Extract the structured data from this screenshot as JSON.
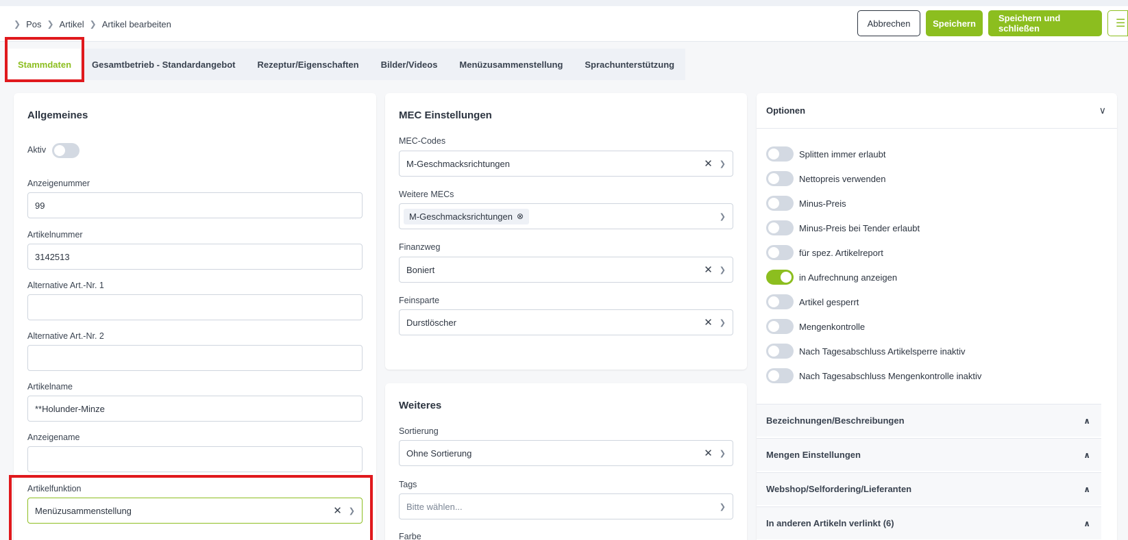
{
  "breadcrumb": [
    "Pos",
    "Artikel",
    "Artikel bearbeiten"
  ],
  "actions": {
    "cancel": "Abbrechen",
    "save": "Speichern",
    "save_close": "Speichern und schließen",
    "menu_icon": "hamburger-icon"
  },
  "tabs": [
    "Stammdaten",
    "Gesamtbetrieb - Standardangebot",
    "Rezeptur/Eigenschaften",
    "Bilder/Videos",
    "Menüzusammenstellung",
    "Sprachunterstützung"
  ],
  "general": {
    "title": "Allgemeines",
    "active_label": "Aktiv",
    "display_number_label": "Anzeigenummer",
    "display_number": "99",
    "article_number_label": "Artikelnummer",
    "article_number": "3142513",
    "alt1_label": "Alternative Art.-Nr. 1",
    "alt1": "",
    "alt2_label": "Alternative Art.-Nr. 2",
    "alt2": "",
    "name_label": "Artikelname",
    "name": "**Holunder-Minze",
    "display_name_label": "Anzeigename",
    "display_name": "",
    "function_label": "Artikelfunktion",
    "function": "Menüzusammenstellung"
  },
  "mec": {
    "title": "MEC Einstellungen",
    "codes_label": "MEC-Codes",
    "codes": "M-Geschmacksrichtungen",
    "more_label": "Weitere MECs",
    "more_chip": "M-Geschmacksrichtungen",
    "finance_label": "Finanzweg",
    "finance": "Boniert",
    "division_label": "Feinsparte",
    "division": "Durstlöscher"
  },
  "more": {
    "title": "Weiteres",
    "sort_label": "Sortierung",
    "sort": "Ohne Sortierung",
    "tags_label": "Tags",
    "tags_placeholder": "Bitte wählen...",
    "color_label": "Farbe"
  },
  "options": {
    "title": "Optionen",
    "items": [
      {
        "label": "Splitten immer erlaubt",
        "on": false
      },
      {
        "label": "Nettopreis verwenden",
        "on": false
      },
      {
        "label": "Minus-Preis",
        "on": false
      },
      {
        "label": "Minus-Preis bei Tender erlaubt",
        "on": false
      },
      {
        "label": "für spez. Artikelreport",
        "on": false
      },
      {
        "label": "in Aufrechnung anzeigen",
        "on": true
      },
      {
        "label": "Artikel gesperrt",
        "on": false
      },
      {
        "label": "Mengenkontrolle",
        "on": false
      },
      {
        "label": "Nach Tagesabschluss Artikelsperre inaktiv",
        "on": false
      },
      {
        "label": "Nach Tagesabschluss Mengenkontrolle inaktiv",
        "on": false
      }
    ],
    "sections": [
      "Bezeichnungen/Beschreibungen",
      "Mengen Einstellungen",
      "Webshop/Selfordering/Lieferanten",
      "In anderen Artikeln verlinkt (6)"
    ]
  },
  "colors": {
    "accent": "#8cbe1f",
    "highlight": "#e0191d"
  }
}
